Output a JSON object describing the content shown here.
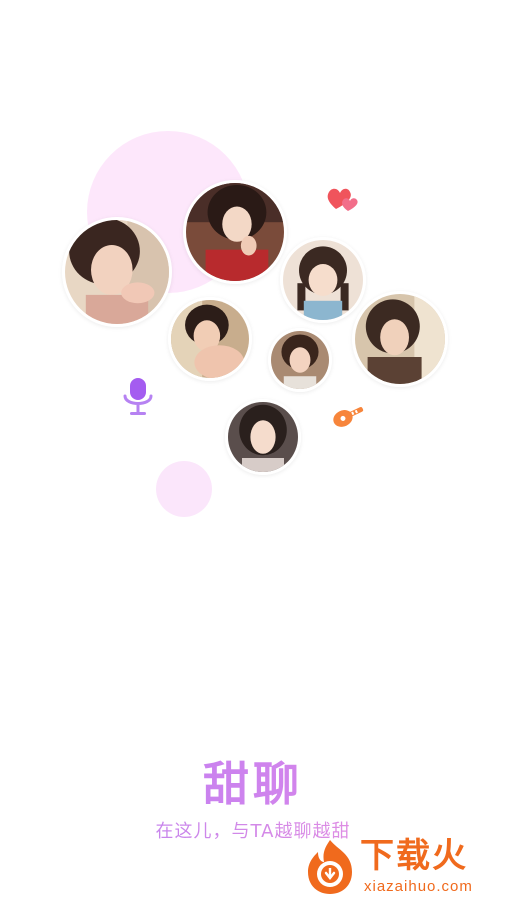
{
  "splash": {
    "title": "甜聊",
    "slogan": "在这儿，与TA越聊越甜"
  },
  "avatars": [
    {
      "name": "avatar-1"
    },
    {
      "name": "avatar-2"
    },
    {
      "name": "avatar-3"
    },
    {
      "name": "avatar-4"
    },
    {
      "name": "avatar-5"
    },
    {
      "name": "avatar-6"
    },
    {
      "name": "avatar-7"
    }
  ],
  "icons": {
    "hearts": "hearts-icon",
    "mic": "microphone-icon",
    "guitar": "guitar-icon",
    "watermark_logo": "fire-logo-icon"
  },
  "watermark": {
    "name": "下载火",
    "url": "xiazaihuo.com"
  },
  "colors": {
    "accent_purple": "#b97cf4",
    "accent_pink": "#e38ae7",
    "bubble_pink": "#fde7fb",
    "mic_purple": "#a45cf0",
    "hearts_red": "#f0545c",
    "guitar_orange": "#f7853b",
    "watermark_orange": "#f06a1d"
  }
}
